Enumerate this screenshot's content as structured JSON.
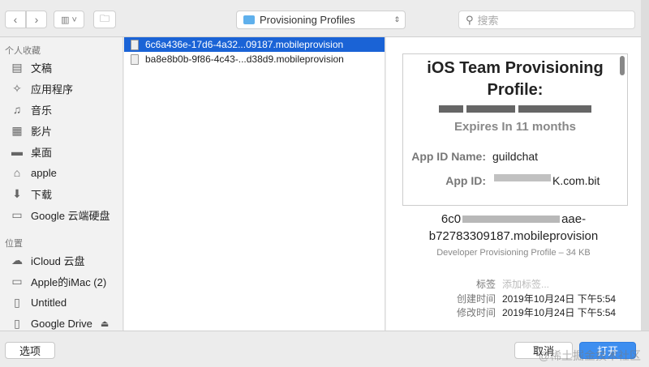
{
  "toolbar": {
    "back_icon": "chevron-left",
    "forward_icon": "chevron-right",
    "view_icon": "columns-view",
    "new_folder_icon": "new-folder",
    "location": "Provisioning Profiles",
    "search_placeholder": "搜索"
  },
  "sidebar": {
    "favorites_label": "个人收藏",
    "favorites": [
      {
        "label": "文稿",
        "icon": "document"
      },
      {
        "label": "应用程序",
        "icon": "apps"
      },
      {
        "label": "音乐",
        "icon": "music"
      },
      {
        "label": "影片",
        "icon": "film"
      },
      {
        "label": "桌面",
        "icon": "desktop"
      },
      {
        "label": "apple",
        "icon": "home"
      },
      {
        "label": "下载",
        "icon": "download"
      },
      {
        "label": "Google 云端硬盘",
        "icon": "folder"
      }
    ],
    "locations_label": "位置",
    "locations": [
      {
        "label": "iCloud 云盘",
        "icon": "cloud"
      },
      {
        "label": "Apple的iMac (2)",
        "icon": "imac"
      },
      {
        "label": "Untitled",
        "icon": "disk"
      },
      {
        "label": "Google Drive",
        "icon": "disk"
      }
    ]
  },
  "files": [
    "6c6a436e-17d6-4a32...09187.mobileprovision",
    "ba8e8b0b-9f86-4c43-...d38d9.mobileprovision"
  ],
  "preview": {
    "title": "iOS Team Provisioning Profile:",
    "expires": "Expires In 11 months",
    "app_id_name_label": "App ID Name:",
    "app_id_name": "guildchat",
    "app_id_label": "App ID:",
    "app_id_suffix": "K.com.bit",
    "file_name_line1": "6c0",
    "file_name_line1_end": "aae-",
    "file_name_line2": "b72783309187.mobileprovision",
    "kind_size": "Developer Provisioning Profile – 34 KB",
    "tags_label": "标签",
    "tags_placeholder": "添加标签...",
    "created_label": "创建时间",
    "created": "2019年10月24日 下午5:54",
    "modified_label": "修改时间",
    "modified": "2019年10月24日 下午5:54"
  },
  "bottom": {
    "options": "选项",
    "cancel": "取消",
    "open": "打开",
    "watermark": "@稀土掘金技术社区"
  }
}
